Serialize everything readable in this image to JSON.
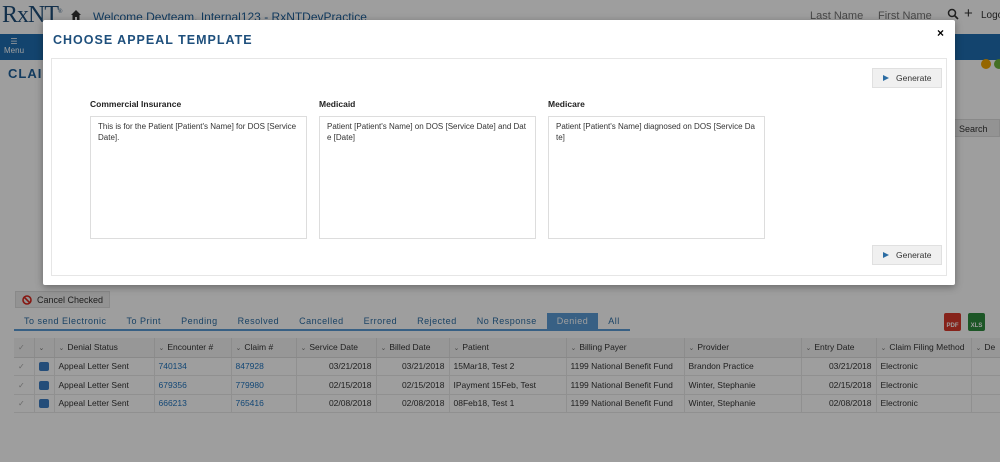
{
  "app": {
    "logo": "RxNT",
    "welcome": "Welcome  Devteam, Internal123 - RxNTDevPractice",
    "last_name_placeholder": "Last Name",
    "first_name_placeholder": "First Name",
    "logout": "Logout",
    "menu_label": "Menu",
    "page_title": "CLAIM",
    "search_button": "Search"
  },
  "toolbar": {
    "cancel_checked": "Cancel Checked"
  },
  "tabs": [
    {
      "label": "To send Electronic",
      "active": false
    },
    {
      "label": "To Print",
      "active": false
    },
    {
      "label": "Pending",
      "active": false
    },
    {
      "label": "Resolved",
      "active": false
    },
    {
      "label": "Cancelled",
      "active": false
    },
    {
      "label": "Errored",
      "active": false
    },
    {
      "label": "Rejected",
      "active": false
    },
    {
      "label": "No Response",
      "active": false
    },
    {
      "label": "Denied",
      "active": true
    },
    {
      "label": "All",
      "active": false
    }
  ],
  "export_icons": {
    "pdf": "PDF",
    "xls": "XLS"
  },
  "table": {
    "columns": [
      "Denial Status",
      "Encounter #",
      "Claim #",
      "Service Date",
      "Billed Date",
      "Patient",
      "Billing Payer",
      "Provider",
      "Entry Date",
      "Claim Filing Method",
      "De"
    ],
    "rows": [
      [
        "Appeal Letter Sent",
        "740134",
        "847928",
        "03/21/2018",
        "03/21/2018",
        "15Mar18, Test 2",
        "1199 National Benefit Fund",
        "Brandon Practice",
        "03/21/2018",
        "Electronic",
        ""
      ],
      [
        "Appeal Letter Sent",
        "679356",
        "779980",
        "02/15/2018",
        "02/15/2018",
        "IPayment 15Feb, Test",
        "1199 National Benefit Fund",
        "Winter, Stephanie",
        "02/15/2018",
        "Electronic",
        ""
      ],
      [
        "Appeal Letter Sent",
        "666213",
        "765416",
        "02/08/2018",
        "02/08/2018",
        "08Feb18, Test 1",
        "1199 National Benefit Fund",
        "Winter, Stephanie",
        "02/08/2018",
        "Electronic",
        ""
      ]
    ]
  },
  "modal": {
    "title": "CHOOSE APPEAL TEMPLATE",
    "close": "×",
    "generate_label": "Generate",
    "templates": [
      {
        "label": "Commercial Insurance",
        "text": "This is for the Patient [Patient's Name] for DOS [Service Date]."
      },
      {
        "label": "Medicaid",
        "text": "Patient [Patient's Name] on DOS [Service Date] and Date [Date]"
      },
      {
        "label": "Medicare",
        "text": "Patient [Patient's Name] diagnosed on DOS [Service Date]"
      }
    ]
  },
  "colors": {
    "brand_blue": "#1f6fb2",
    "title_blue": "#1e4f7c",
    "link_blue": "#1e73be",
    "active_tab": "#5b9bd5"
  }
}
